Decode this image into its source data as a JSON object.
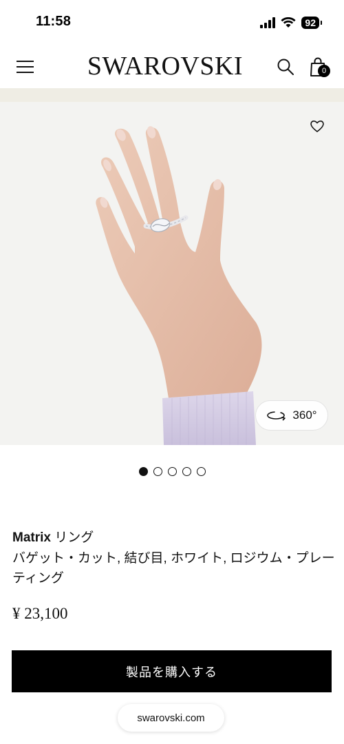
{
  "status_bar": {
    "time": "11:58",
    "battery": "92",
    "icons": [
      "signal-icon",
      "wifi-icon",
      "battery-icon"
    ]
  },
  "header": {
    "brand": "SWAROVSKI",
    "bag_count": "0",
    "icons": [
      "menu-icon",
      "search-icon",
      "shopping-bag-icon"
    ]
  },
  "gallery": {
    "view360_label": "360°",
    "slide_count": 5,
    "active_slide": 1,
    "icons": [
      "heart-icon",
      "rotate-360-icon"
    ]
  },
  "product": {
    "collection": "Matrix",
    "type": " リング",
    "description": "バゲット・カット, 結び目, ホワイト, ロジウム・プレーティング",
    "price": "¥ 23,100",
    "buy_label": "製品を購入する"
  },
  "browser": {
    "url": "swarovski.com"
  },
  "colors": {
    "accent": "#000000",
    "strip": "#efede4",
    "image_bg": "#f3f3f1",
    "sleeve": "#cfc7e0"
  }
}
